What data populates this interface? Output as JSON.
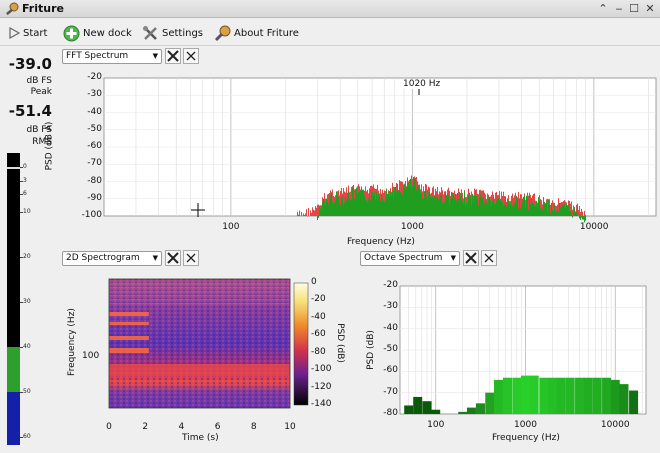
{
  "window": {
    "title": "Friture"
  },
  "toolbar": {
    "start": "Start",
    "new_dock": "New dock",
    "settings": "Settings",
    "about": "About Friture"
  },
  "levels": {
    "peak_value": "-39.0",
    "peak_label_1": "dB FS",
    "peak_label_2": "Peak",
    "rms_value": "-51.4",
    "rms_label_1": "dB FS",
    "rms_label_2": "RMS",
    "meter_ticks": [
      "0",
      "3",
      "6",
      "10",
      "20",
      "30",
      "40",
      "50",
      "60"
    ],
    "level_green_db": 40,
    "level_blue_db": 50,
    "peak_hold_db": 0,
    "colors": {
      "green": "#2c9f2c",
      "blue": "#1420a8"
    }
  },
  "docks": {
    "fft": {
      "selector": "FFT Spectrum",
      "y_ticks": [
        "-20",
        "-30",
        "-40",
        "-50",
        "-60",
        "-70",
        "-80",
        "-90",
        "-100"
      ],
      "x_ticks": [
        "100",
        "1000",
        "10000"
      ],
      "xlabel": "Frequency (Hz)",
      "ylabel": "PSD (dB A)",
      "peak_marker": "1020 Hz"
    },
    "spectrogram": {
      "selector": "2D Spectrogram",
      "x_ticks": [
        "0",
        "2",
        "4",
        "6",
        "8",
        "10"
      ],
      "y_ticks": [
        "100"
      ],
      "xlabel": "Time (s)",
      "ylabel": "Frequency (Hz)",
      "colorbar_ticks": [
        "0",
        "-20",
        "-40",
        "-60",
        "-80",
        "-100",
        "-120",
        "-140"
      ],
      "colorbar_label": "PSD (dB)"
    },
    "octave": {
      "selector": "Octave Spectrum",
      "y_ticks": [
        "-20",
        "-30",
        "-40",
        "-50",
        "-60",
        "-70",
        "-80"
      ],
      "x_ticks": [
        "100",
        "1000",
        "10000"
      ],
      "xlabel": "Frequency (Hz)",
      "ylabel": "PSD (dB)"
    }
  },
  "chart_data": [
    {
      "type": "area",
      "name": "fft-spectrum",
      "x_scale": "log",
      "xlim": [
        20,
        22000
      ],
      "ylim": [
        -100,
        -20
      ],
      "x": [
        230,
        260,
        300,
        330,
        360,
        400,
        450,
        500,
        560,
        630,
        700,
        800,
        900,
        1000,
        1020,
        1100,
        1300,
        1500,
        1800,
        2200,
        2700,
        3300,
        4000,
        5000,
        6000,
        7000,
        8000,
        9000
      ],
      "y": [
        -99,
        -97,
        -95,
        -88,
        -85,
        -86,
        -84,
        -83,
        -85,
        -83,
        -84,
        -82,
        -80,
        -78,
        -76,
        -82,
        -84,
        -85,
        -86,
        -86,
        -87,
        -88,
        -88,
        -89,
        -91,
        -92,
        -94,
        -97
      ],
      "grid": true
    },
    {
      "type": "heatmap",
      "name": "2d-spectrogram",
      "xlim": [
        0,
        10
      ],
      "color_scale": [
        -140,
        0
      ],
      "y_scale": "log"
    },
    {
      "type": "bar",
      "name": "octave-spectrum",
      "x_scale": "log",
      "xlim": [
        40,
        22000
      ],
      "ylim": [
        -80,
        -20
      ],
      "x": [
        50,
        63,
        80,
        100,
        125,
        160,
        200,
        250,
        315,
        400,
        500,
        630,
        800,
        1000,
        1250,
        1600,
        2000,
        2500,
        3150,
        4000,
        5000,
        6300,
        8000,
        10000,
        12500,
        16000
      ],
      "values": [
        -76,
        -72,
        -74,
        -78,
        -80,
        -80,
        -79,
        -77,
        -75,
        -70,
        -64,
        -63,
        -63,
        -62,
        -62,
        -63,
        -63,
        -63,
        -63,
        -63,
        -63,
        -63,
        -63,
        -64,
        -66,
        -69
      ],
      "colors": [
        "#0b5a0b",
        "#0b5a0b",
        "#0b5a0b",
        "#0b5a0b",
        "#0b5a0b",
        "#0b5a0b",
        "#1c7a1c",
        "#1c7a1c",
        "#1f8a1f",
        "#21a321",
        "#24b824",
        "#26c426",
        "#28cc28",
        "#2ad02a",
        "#28cc28",
        "#26c426",
        "#25be25",
        "#24b824",
        "#24b824",
        "#23b423",
        "#22ae22",
        "#22ae22",
        "#20a820",
        "#1c9a1c",
        "#1a8c1a",
        "#136f13"
      ]
    }
  ]
}
